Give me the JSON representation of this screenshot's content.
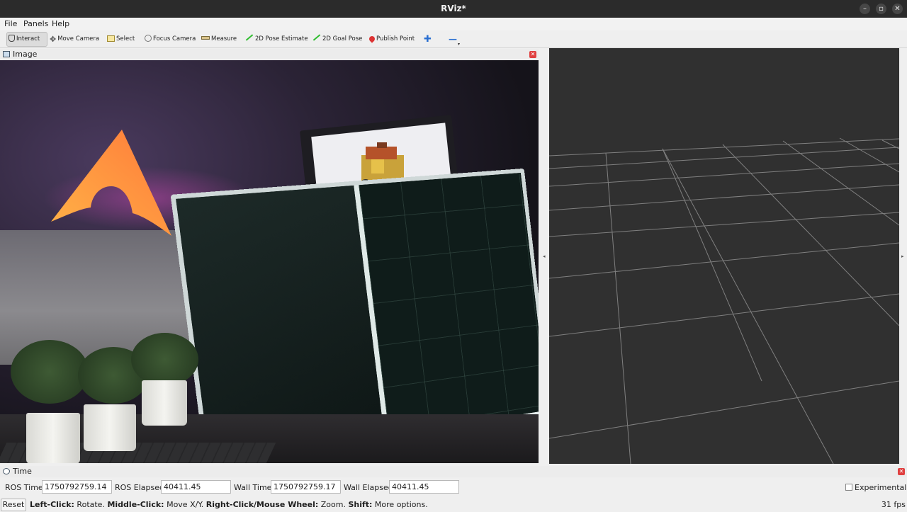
{
  "window": {
    "title": "RViz*"
  },
  "menu": {
    "file": "File",
    "panels": "Panels",
    "help": "Help"
  },
  "toolbar": {
    "interact": "Interact",
    "move_camera": "Move Camera",
    "select": "Select",
    "focus_camera": "Focus Camera",
    "measure": "Measure",
    "pose_estimate": "2D Pose Estimate",
    "goal_pose": "2D Goal Pose",
    "publish_point": "Publish Point",
    "add_tool_icon": "plus-icon",
    "remove_tool_icon": "minus-icon"
  },
  "image_panel": {
    "title": "Image"
  },
  "time_panel": {
    "title": "Time",
    "ros_time_label": "ROS Time:",
    "ros_time_value": "1750792759.14",
    "ros_elapsed_label": "ROS Elapsed:",
    "ros_elapsed_value": "40411.45",
    "wall_time_label": "Wall Time:",
    "wall_time_value": "1750792759.17",
    "wall_elapsed_label": "Wall Elapsed:",
    "wall_elapsed_value": "40411.45",
    "experimental_label": "Experimental"
  },
  "status": {
    "reset_label": "Reset",
    "left_click": "Left-Click:",
    "left_click_desc": " Rotate. ",
    "middle_click": "Middle-Click:",
    "middle_click_desc": " Move X/Y. ",
    "right_click": "Right-Click/Mouse Wheel:",
    "right_click_desc": " Zoom. ",
    "shift": "Shift:",
    "shift_desc": " More options.",
    "fps": "31 fps"
  },
  "colors": {
    "grid_line": "#a0a0a0",
    "view_bg": "#303030",
    "close_red": "#e04040"
  }
}
